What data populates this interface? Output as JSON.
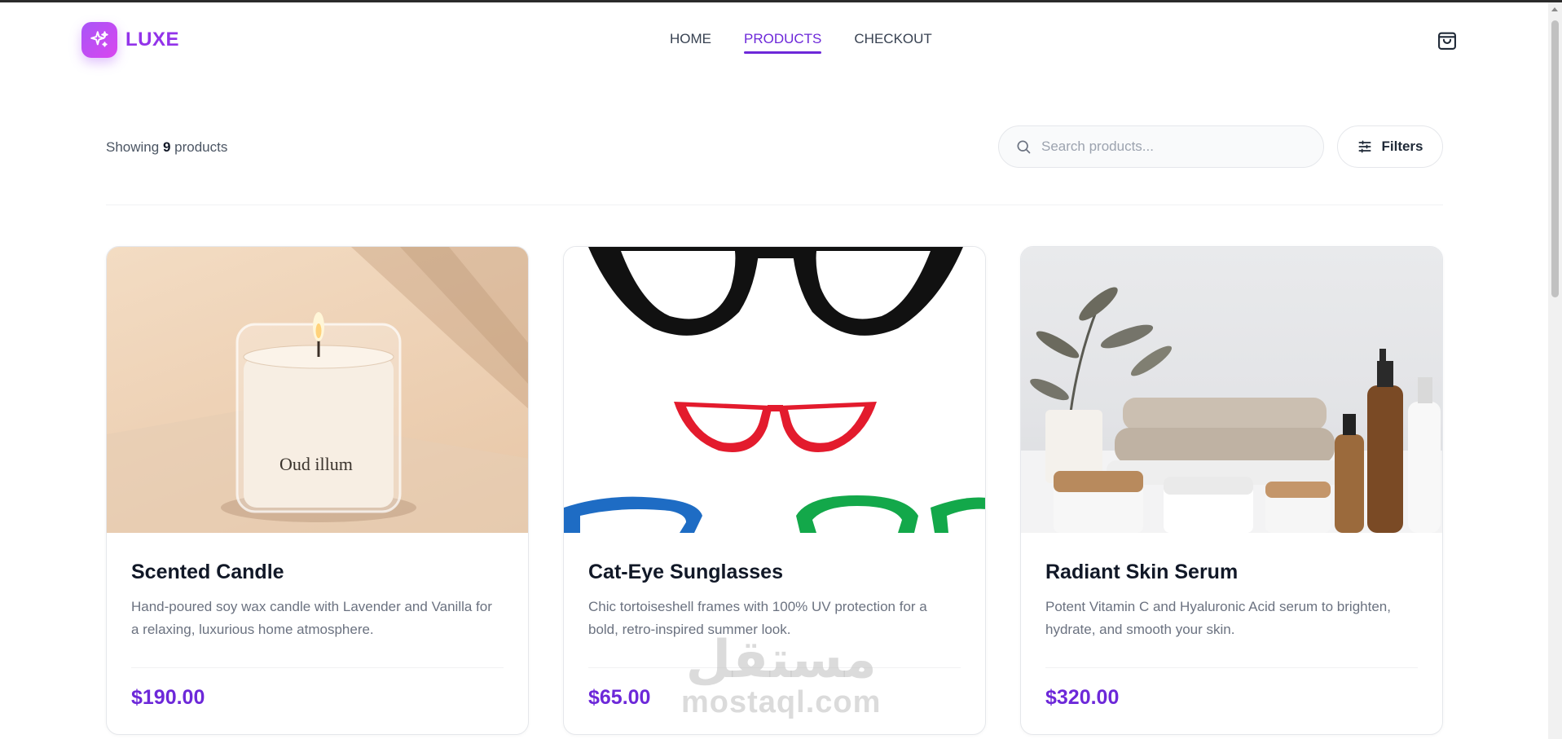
{
  "brand": {
    "name": "LUXE",
    "logo_icon": "sparkles-icon",
    "accent": "#a855f7"
  },
  "nav": {
    "items": [
      {
        "label": "HOME",
        "active": false
      },
      {
        "label": "PRODUCTS",
        "active": true
      },
      {
        "label": "CHECKOUT",
        "active": false
      }
    ],
    "active_color": "#6d28d9"
  },
  "cart": {
    "icon": "shopping-bag-icon"
  },
  "toolbar": {
    "showing_prefix": "Showing",
    "product_count": "9",
    "showing_suffix": "products",
    "search_placeholder": "Search products...",
    "search_value": "",
    "filters_label": "Filters",
    "filters_icon": "sliders-icon"
  },
  "products": [
    {
      "title": "Scented Candle",
      "description": "Hand-poured soy wax candle with Lavender and Vanilla for a relaxing, luxurious home atmosphere.",
      "price": "$190.00",
      "image": "candle-photo",
      "image_label": "Oud illum"
    },
    {
      "title": "Cat-Eye Sunglasses",
      "description": "Chic tortoiseshell frames with 100% UV protection for a bold, retro-inspired summer look.",
      "price": "$65.00",
      "image": "sunglasses-photo"
    },
    {
      "title": "Radiant Skin Serum",
      "description": "Potent Vitamin C and Hyaluronic Acid serum to brighten, hydrate, and smooth your skin.",
      "price": "$320.00",
      "image": "skincare-photo"
    }
  ],
  "watermark": {
    "arabic": "مستقل",
    "latin": "mostaql.com"
  },
  "colors": {
    "price": "#6d28d9",
    "title": "#111827",
    "muted": "#6b7280"
  }
}
